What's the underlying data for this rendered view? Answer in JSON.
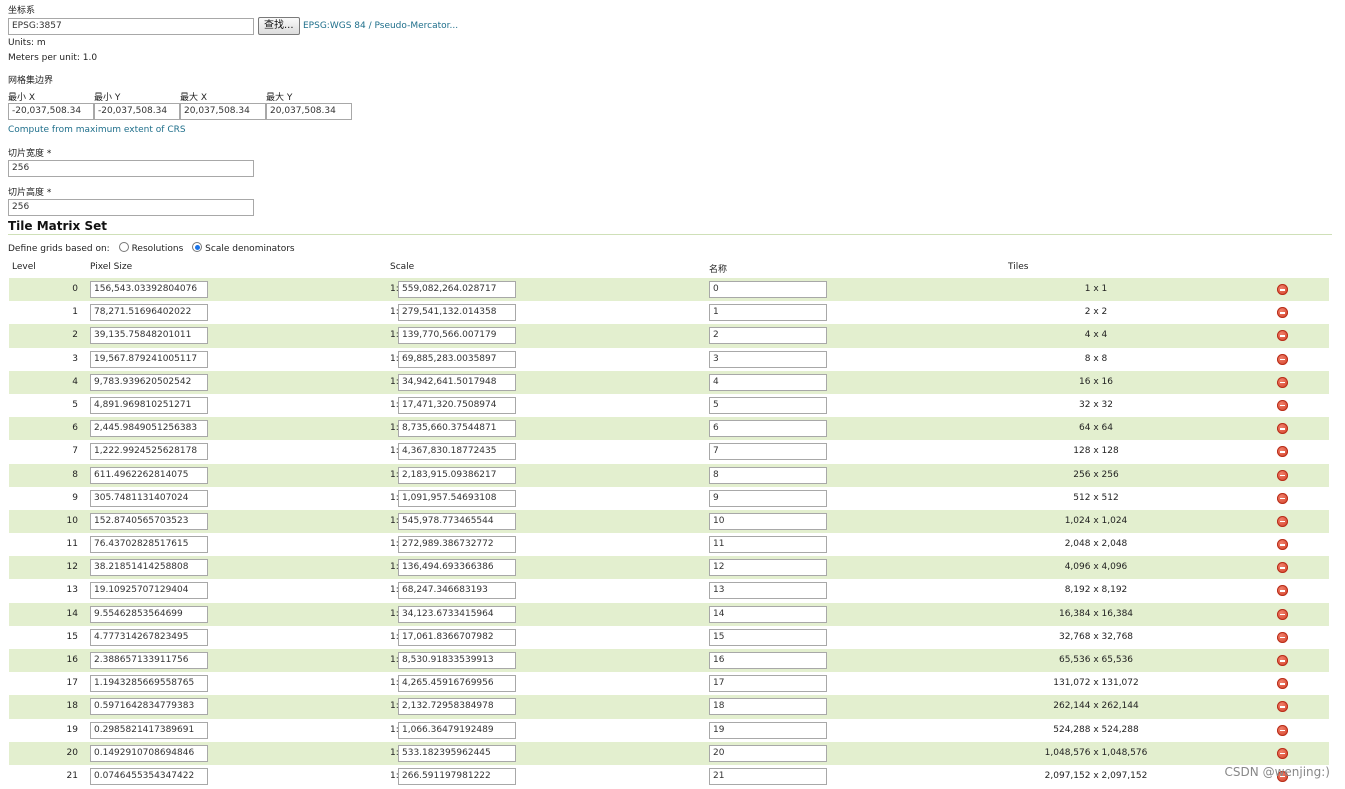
{
  "crs": {
    "label": "坐标系",
    "value": "EPSG:3857",
    "find_button": "查找...",
    "crs_link": "EPSG:WGS 84 / Pseudo-Mercator...",
    "units": "Units: m",
    "meters_per_unit": "Meters per unit: 1.0"
  },
  "bounds": {
    "label": "网格集边界",
    "min_x_label": "最小 X",
    "min_y_label": "最小 Y",
    "max_x_label": "最大 X",
    "max_y_label": "最大 Y",
    "min_x": "-20,037,508.34",
    "min_y": "-20,037,508.34",
    "max_x": "20,037,508.34",
    "max_y": "20,037,508.34",
    "compute_link": "Compute from maximum extent of CRS"
  },
  "tile_width": {
    "label": "切片宽度 *",
    "value": "256"
  },
  "tile_height": {
    "label": "切片高度 *",
    "value": "256"
  },
  "matrix": {
    "title": "Tile Matrix Set",
    "define_label": "Define grids based on:",
    "option_resolutions": "Resolutions",
    "option_scale": "Scale denominators",
    "selected": "Scale denominators",
    "col_level": "Level",
    "col_pixel": "Pixel Size",
    "col_scale": "Scale",
    "col_name": "名称",
    "col_tiles": "Tiles",
    "scale_prefix": "1:",
    "rows": [
      {
        "level": "0",
        "pixel": "156,543.03392804076",
        "scale": "559,082,264.028717",
        "name": "0",
        "tiles": "1 x 1"
      },
      {
        "level": "1",
        "pixel": "78,271.51696402022",
        "scale": "279,541,132.014358",
        "name": "1",
        "tiles": "2 x 2"
      },
      {
        "level": "2",
        "pixel": "39,135.75848201011",
        "scale": "139,770,566.007179",
        "name": "2",
        "tiles": "4 x 4"
      },
      {
        "level": "3",
        "pixel": "19,567.879241005117",
        "scale": "69,885,283.0035897",
        "name": "3",
        "tiles": "8 x 8"
      },
      {
        "level": "4",
        "pixel": "9,783.939620502542",
        "scale": "34,942,641.5017948",
        "name": "4",
        "tiles": "16 x 16"
      },
      {
        "level": "5",
        "pixel": "4,891.969810251271",
        "scale": "17,471,320.7508974",
        "name": "5",
        "tiles": "32 x 32"
      },
      {
        "level": "6",
        "pixel": "2,445.9849051256383",
        "scale": "8,735,660.37544871",
        "name": "6",
        "tiles": "64 x 64"
      },
      {
        "level": "7",
        "pixel": "1,222.9924525628178",
        "scale": "4,367,830.18772435",
        "name": "7",
        "tiles": "128 x 128"
      },
      {
        "level": "8",
        "pixel": "611.4962262814075",
        "scale": "2,183,915.09386217",
        "name": "8",
        "tiles": "256 x 256"
      },
      {
        "level": "9",
        "pixel": "305.7481131407024",
        "scale": "1,091,957.54693108",
        "name": "9",
        "tiles": "512 x 512"
      },
      {
        "level": "10",
        "pixel": "152.8740565703523",
        "scale": "545,978.773465544",
        "name": "10",
        "tiles": "1,024 x 1,024"
      },
      {
        "level": "11",
        "pixel": "76.43702828517615",
        "scale": "272,989.386732772",
        "name": "11",
        "tiles": "2,048 x 2,048"
      },
      {
        "level": "12",
        "pixel": "38.21851414258808",
        "scale": "136,494.693366386",
        "name": "12",
        "tiles": "4,096 x 4,096"
      },
      {
        "level": "13",
        "pixel": "19.10925707129404",
        "scale": "68,247.346683193",
        "name": "13",
        "tiles": "8,192 x 8,192"
      },
      {
        "level": "14",
        "pixel": "9.55462853564699",
        "scale": "34,123.6733415964",
        "name": "14",
        "tiles": "16,384 x 16,384"
      },
      {
        "level": "15",
        "pixel": "4.777314267823495",
        "scale": "17,061.8366707982",
        "name": "15",
        "tiles": "32,768 x 32,768"
      },
      {
        "level": "16",
        "pixel": "2.388657133911756",
        "scale": "8,530.91833539913",
        "name": "16",
        "tiles": "65,536 x 65,536"
      },
      {
        "level": "17",
        "pixel": "1.1943285669558765",
        "scale": "4,265.45916769956",
        "name": "17",
        "tiles": "131,072 x 131,072"
      },
      {
        "level": "18",
        "pixel": "0.5971642834779383",
        "scale": "2,132.72958384978",
        "name": "18",
        "tiles": "262,144 x 262,144"
      },
      {
        "level": "19",
        "pixel": "0.2985821417389691",
        "scale": "1,066.36479192489",
        "name": "19",
        "tiles": "524,288 x 524,288"
      },
      {
        "level": "20",
        "pixel": "0.1492910708694846",
        "scale": "533.182395962445",
        "name": "20",
        "tiles": "1,048,576 x 1,048,576"
      },
      {
        "level": "21",
        "pixel": "0.0746455354347422",
        "scale": "266.591197981222",
        "name": "21",
        "tiles": "2,097,152 x 2,097,152"
      }
    ]
  },
  "watermark": "CSDN @wenjing:)",
  "colors": {
    "row_alt": "#e3efcf",
    "link": "#1f6f8b",
    "remove": "#d23b22"
  },
  "icons": {
    "remove": "remove-circle-icon"
  }
}
